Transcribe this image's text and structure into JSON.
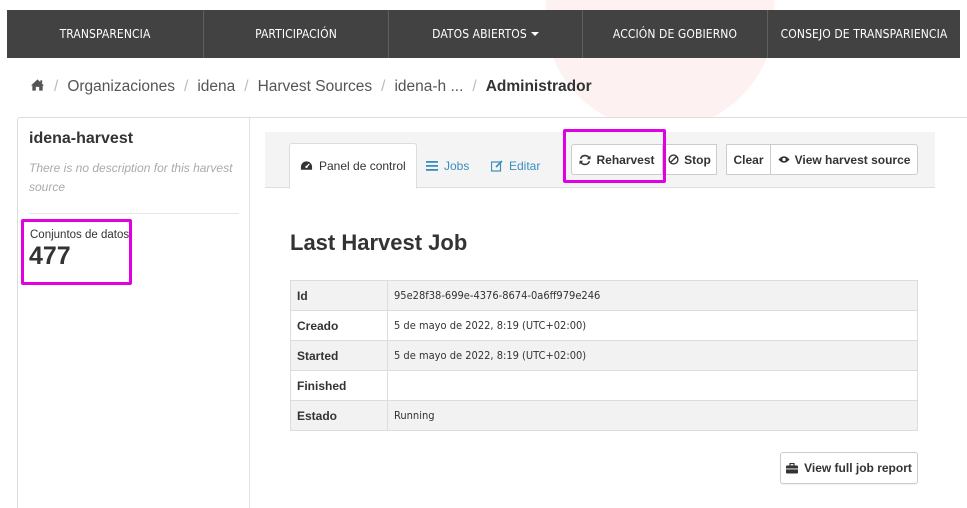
{
  "nav": {
    "items": [
      {
        "label": "TRANSPARENCIA"
      },
      {
        "label": "PARTICIPACIÓN"
      },
      {
        "label": "DATOS ABIERTOS"
      },
      {
        "label": "ACCIÓN DE GOBIERNO"
      },
      {
        "label": "CONSEJO DE TRANSPARIENCIA"
      }
    ],
    "background": "#424242"
  },
  "breadcrumb": {
    "home_icon": "home-icon",
    "items": [
      "Organizaciones",
      "idena",
      "Harvest Sources",
      "idena-h ..."
    ],
    "active": "Administrador"
  },
  "sidebar": {
    "source_name": "idena-harvest",
    "description": "There is no description for this harvest source",
    "stat_label": "Conjuntos de datos",
    "stat_value": "477"
  },
  "tabs": {
    "dashboard": "Panel de control",
    "jobs": "Jobs",
    "edit": "Editar"
  },
  "actions": {
    "reharvest": "Reharvest",
    "stop": "Stop",
    "clear": "Clear",
    "view_source": "View harvest source"
  },
  "job": {
    "title": "Last Harvest Job",
    "rows": [
      {
        "key": "Id",
        "value": "95e28f38-699e-4376-8674-0a6ff979e246"
      },
      {
        "key": "Creado",
        "value": "5 de mayo de 2022, 8:19 (UTC+02:00)"
      },
      {
        "key": "Started",
        "value": "5 de mayo de 2022, 8:19 (UTC+02:00)"
      },
      {
        "key": "Finished",
        "value": ""
      },
      {
        "key": "Estado",
        "value": "Running"
      }
    ],
    "report_button": "View full job report"
  },
  "colors": {
    "link": "#3c8dbc",
    "highlight": "#e100e1"
  }
}
